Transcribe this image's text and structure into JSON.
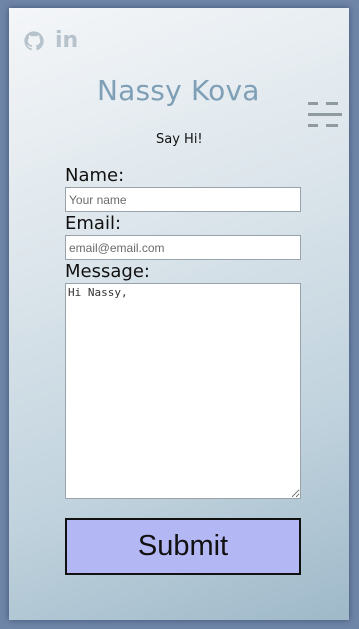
{
  "header": {
    "social_icons": [
      "github-icon",
      "linkedin-icon"
    ],
    "linkedin_text": "in",
    "brand": "Nassy Kova",
    "menu_icon": "hamburger-menu-icon"
  },
  "intro": "Say Hi!",
  "form": {
    "name_label": "Name:",
    "name_placeholder": "Your name",
    "email_label": "Email:",
    "email_placeholder": "email@email.com",
    "message_label": "Message:",
    "message_value": "Hi Nassy,",
    "submit_label": "Submit"
  },
  "colors": {
    "brand": "#7e9fb6",
    "submit_bg": "#b3b7f3",
    "icon": "#b6c3cc"
  }
}
